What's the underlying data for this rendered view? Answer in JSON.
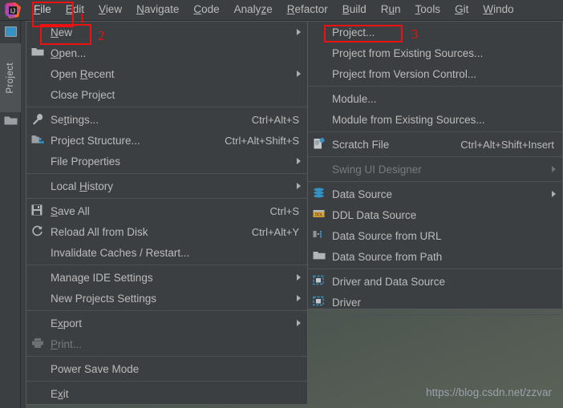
{
  "app": {
    "logo_icon": "intellij-idea-logo"
  },
  "menubar": {
    "items": [
      {
        "label": "File",
        "mnemonic": "F",
        "active": true
      },
      {
        "label": "Edit",
        "mnemonic": "E",
        "active": false
      },
      {
        "label": "View",
        "mnemonic": "V",
        "active": false
      },
      {
        "label": "Navigate",
        "mnemonic": "N",
        "active": false
      },
      {
        "label": "Code",
        "mnemonic": "C",
        "active": false
      },
      {
        "label": "Analyze",
        "mnemonic": "z",
        "active": false
      },
      {
        "label": "Refactor",
        "mnemonic": "R",
        "active": false
      },
      {
        "label": "Build",
        "mnemonic": "B",
        "active": false
      },
      {
        "label": "Run",
        "mnemonic": "u",
        "active": false
      },
      {
        "label": "Tools",
        "mnemonic": "T",
        "active": false
      },
      {
        "label": "Git",
        "mnemonic": "G",
        "active": false
      },
      {
        "label": "Windo",
        "mnemonic": "W",
        "active": false
      }
    ]
  },
  "sidebar": {
    "project_tab_label": "Project",
    "window_icon": "project-window-icon",
    "folder_icon": "folder-icon"
  },
  "file_menu": {
    "items": [
      {
        "label": "New",
        "icon": "",
        "accel": "",
        "arrow": true,
        "disabled": false,
        "highlight": true
      },
      {
        "label": "Open...",
        "icon": "folder-icon",
        "accel": "",
        "arrow": false,
        "disabled": false
      },
      {
        "label": "Open Recent",
        "icon": "",
        "accel": "",
        "arrow": true,
        "disabled": false
      },
      {
        "label": "Close Project",
        "icon": "",
        "accel": "",
        "arrow": false,
        "disabled": false
      },
      {
        "separator": true
      },
      {
        "label": "Settings...",
        "icon": "wrench-icon",
        "accel": "Ctrl+Alt+S",
        "arrow": false,
        "disabled": false
      },
      {
        "label": "Project Structure...",
        "icon": "project-structure-icon",
        "accel": "Ctrl+Alt+Shift+S",
        "arrow": false,
        "disabled": false
      },
      {
        "label": "File Properties",
        "icon": "",
        "accel": "",
        "arrow": true,
        "disabled": false
      },
      {
        "separator": true
      },
      {
        "label": "Local History",
        "icon": "",
        "accel": "",
        "arrow": true,
        "disabled": false
      },
      {
        "separator": true
      },
      {
        "label": "Save All",
        "icon": "save-icon",
        "accel": "Ctrl+S",
        "arrow": false,
        "disabled": false
      },
      {
        "label": "Reload All from Disk",
        "icon": "refresh-icon",
        "accel": "Ctrl+Alt+Y",
        "arrow": false,
        "disabled": false
      },
      {
        "label": "Invalidate Caches / Restart...",
        "icon": "",
        "accel": "",
        "arrow": false,
        "disabled": false
      },
      {
        "separator": true
      },
      {
        "label": "Manage IDE Settings",
        "icon": "",
        "accel": "",
        "arrow": true,
        "disabled": false
      },
      {
        "label": "New Projects Settings",
        "icon": "",
        "accel": "",
        "arrow": true,
        "disabled": false
      },
      {
        "separator": true
      },
      {
        "label": "Export",
        "icon": "",
        "accel": "",
        "arrow": true,
        "disabled": false
      },
      {
        "label": "Print...",
        "icon": "printer-icon",
        "accel": "",
        "arrow": false,
        "disabled": true
      },
      {
        "separator": true
      },
      {
        "label": "Power Save Mode",
        "icon": "",
        "accel": "",
        "arrow": false,
        "disabled": false
      },
      {
        "separator": true
      },
      {
        "label": "Exit",
        "icon": "",
        "accel": "",
        "arrow": false,
        "disabled": false
      }
    ]
  },
  "new_submenu": {
    "items": [
      {
        "label": "Project...",
        "icon": "",
        "accel": "",
        "arrow": false,
        "disabled": false,
        "highlight": true
      },
      {
        "label": "Project from Existing Sources...",
        "icon": "",
        "accel": "",
        "arrow": false,
        "disabled": false
      },
      {
        "label": "Project from Version Control...",
        "icon": "",
        "accel": "",
        "arrow": false,
        "disabled": false
      },
      {
        "separator": true
      },
      {
        "label": "Module...",
        "icon": "",
        "accel": "",
        "arrow": false,
        "disabled": false
      },
      {
        "label": "Module from Existing Sources...",
        "icon": "",
        "accel": "",
        "arrow": false,
        "disabled": false
      },
      {
        "separator": true
      },
      {
        "label": "Scratch File",
        "icon": "scratch-file-icon",
        "accel": "Ctrl+Alt+Shift+Insert",
        "arrow": false,
        "disabled": false
      },
      {
        "separator": true
      },
      {
        "label": "Swing UI Designer",
        "icon": "",
        "accel": "",
        "arrow": true,
        "disabled": true
      },
      {
        "separator": true
      },
      {
        "label": "Data Source",
        "icon": "database-icon",
        "accel": "",
        "arrow": true,
        "disabled": false
      },
      {
        "label": "DDL Data Source",
        "icon": "ddl-icon",
        "accel": "",
        "arrow": false,
        "disabled": false
      },
      {
        "label": "Data Source from URL",
        "icon": "url-source-icon",
        "accel": "",
        "arrow": false,
        "disabled": false
      },
      {
        "label": "Data Source from Path",
        "icon": "folder-icon",
        "accel": "",
        "arrow": false,
        "disabled": false
      },
      {
        "separator": true
      },
      {
        "label": "Driver and Data Source",
        "icon": "driver-icon",
        "accel": "",
        "arrow": false,
        "disabled": false
      },
      {
        "label": "Driver",
        "icon": "driver-icon",
        "accel": "",
        "arrow": false,
        "disabled": false
      },
      {
        "separator": true
      }
    ]
  },
  "annotations": {
    "color": "#ee1111",
    "markers": [
      {
        "number": "1",
        "target": "File"
      },
      {
        "number": "2",
        "target": "New"
      },
      {
        "number": "3",
        "target": "Project..."
      }
    ]
  },
  "watermark": {
    "text": "https://blog.csdn.net/zzvar"
  }
}
